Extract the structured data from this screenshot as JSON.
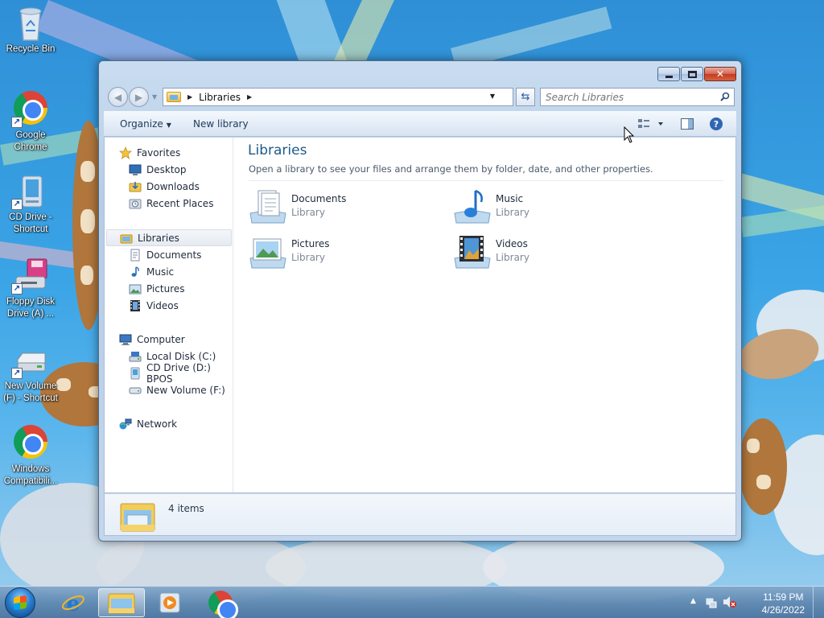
{
  "desktop": {
    "icons": [
      {
        "label": "Recycle Bin",
        "icon": "recycle-bin-icon"
      },
      {
        "label": "Google Chrome",
        "icon": "chrome-icon"
      },
      {
        "label": "CD Drive - Shortcut",
        "icon": "cd-drive-icon"
      },
      {
        "label": "Floppy Disk Drive (A) ...",
        "icon": "floppy-drive-icon"
      },
      {
        "label": "New Volume (F) - Shortcut",
        "icon": "drive-icon"
      },
      {
        "label": "Windows Compatibili...",
        "icon": "chrome-icon"
      }
    ]
  },
  "window": {
    "address": {
      "segments": [
        "Libraries"
      ]
    },
    "search": {
      "placeholder": "Search Libraries"
    },
    "toolbar": {
      "organize_label": "Organize",
      "new_library_label": "New library"
    },
    "nav": {
      "favorites": {
        "label": "Favorites",
        "items": [
          "Desktop",
          "Downloads",
          "Recent Places"
        ]
      },
      "libraries": {
        "label": "Libraries",
        "items": [
          "Documents",
          "Music",
          "Pictures",
          "Videos"
        ]
      },
      "computer": {
        "label": "Computer",
        "items": [
          "Local Disk (C:)",
          "CD Drive (D:) BPOS",
          "New Volume (F:)"
        ]
      },
      "network": {
        "label": "Network"
      }
    },
    "main": {
      "title": "Libraries",
      "description": "Open a library to see your files and arrange them by folder, date, and other properties.",
      "libraries": [
        {
          "name": "Documents",
          "type": "Library",
          "icon": "documents-library-icon"
        },
        {
          "name": "Music",
          "type": "Library",
          "icon": "music-library-icon"
        },
        {
          "name": "Pictures",
          "type": "Library",
          "icon": "pictures-library-icon"
        },
        {
          "name": "Videos",
          "type": "Library",
          "icon": "videos-library-icon"
        }
      ]
    },
    "details": {
      "count": "4 items"
    }
  },
  "taskbar": {
    "apps": [
      {
        "name": "internet-explorer"
      },
      {
        "name": "windows-explorer",
        "active": true
      },
      {
        "name": "media-player"
      },
      {
        "name": "chrome"
      }
    ],
    "clock": {
      "time": "11:59 PM",
      "date": "4/26/2022"
    }
  }
}
